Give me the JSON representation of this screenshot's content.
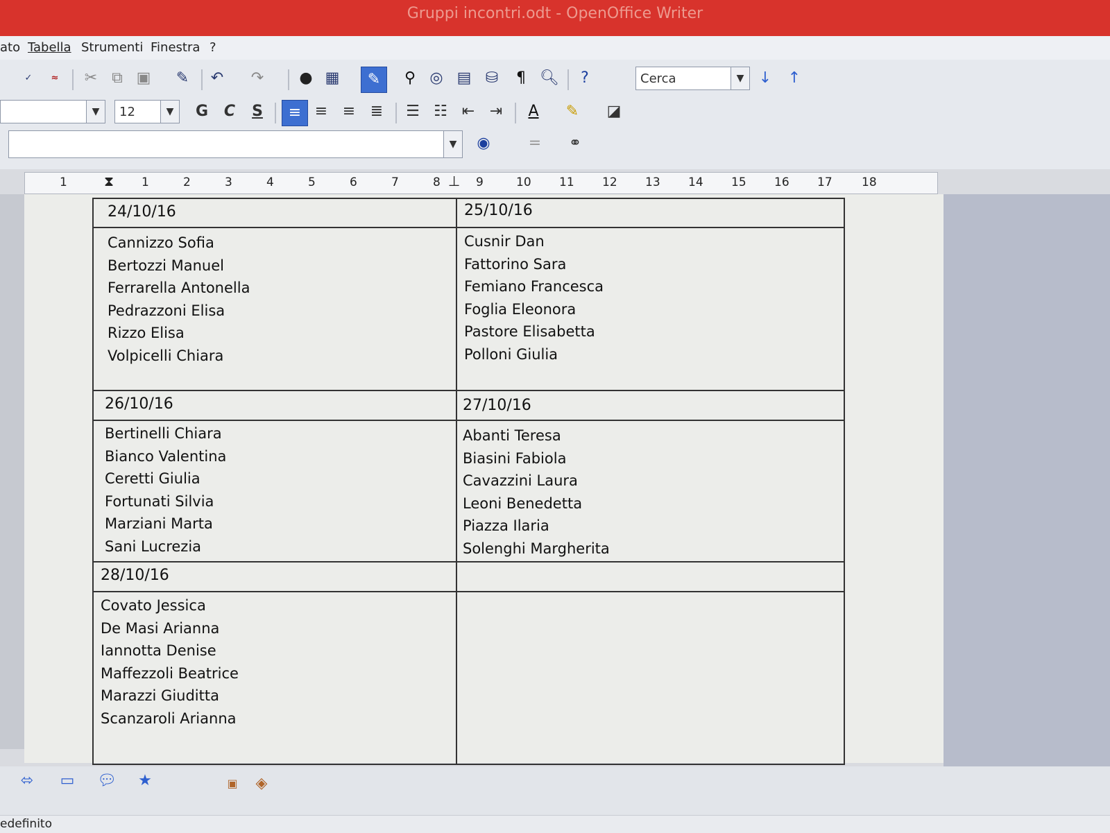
{
  "window": {
    "title": "Gruppi incontri.odt - OpenOffice Writer"
  },
  "menu": {
    "items": [
      "ato",
      "Tabella",
      "Strumenti",
      "Finestra",
      "?"
    ]
  },
  "toolbar": {
    "search_value": "Cerca"
  },
  "format_bar": {
    "font_size": "12",
    "bold_label": "G",
    "italic_label": "C",
    "underline_label": "S"
  },
  "ruler": {
    "marks": [
      "1",
      "1",
      "2",
      "3",
      "4",
      "5",
      "6",
      "7",
      "8",
      "9",
      "10",
      "11",
      "12",
      "13",
      "14",
      "15",
      "16",
      "17",
      "18"
    ]
  },
  "table": {
    "groups": [
      {
        "date": "24/10/16",
        "names": [
          "Cannizzo Sofia",
          "Bertozzi Manuel",
          "Ferrarella Antonella",
          "Pedrazzoni Elisa",
          "Rizzo Elisa",
          "Volpicelli Chiara"
        ]
      },
      {
        "date": "25/10/16",
        "names": [
          "Cusnir Dan",
          "Fattorino Sara",
          "Femiano Francesca",
          "Foglia Eleonora",
          "Pastore Elisabetta",
          "Polloni Giulia"
        ]
      },
      {
        "date": "26/10/16",
        "names": [
          "Bertinelli Chiara",
          "Bianco Valentina",
          "Ceretti Giulia",
          "Fortunati Silvia",
          "Marziani Marta",
          "Sani Lucrezia"
        ]
      },
      {
        "date": "27/10/16",
        "names": [
          "Abanti Teresa",
          "Biasini Fabiola",
          "Cavazzini Laura",
          "Leoni Benedetta",
          "Piazza Ilaria",
          "Solenghi Margherita"
        ]
      },
      {
        "date": "28/10/16",
        "names": [
          "Covato Jessica",
          "De Masi Arianna",
          "Iannotta Denise",
          "Maffezzoli Beatrice",
          "Marazzi Giuditta",
          "Scanzaroli Arianna"
        ]
      }
    ]
  },
  "statusbar": {
    "left": "edefinito"
  }
}
